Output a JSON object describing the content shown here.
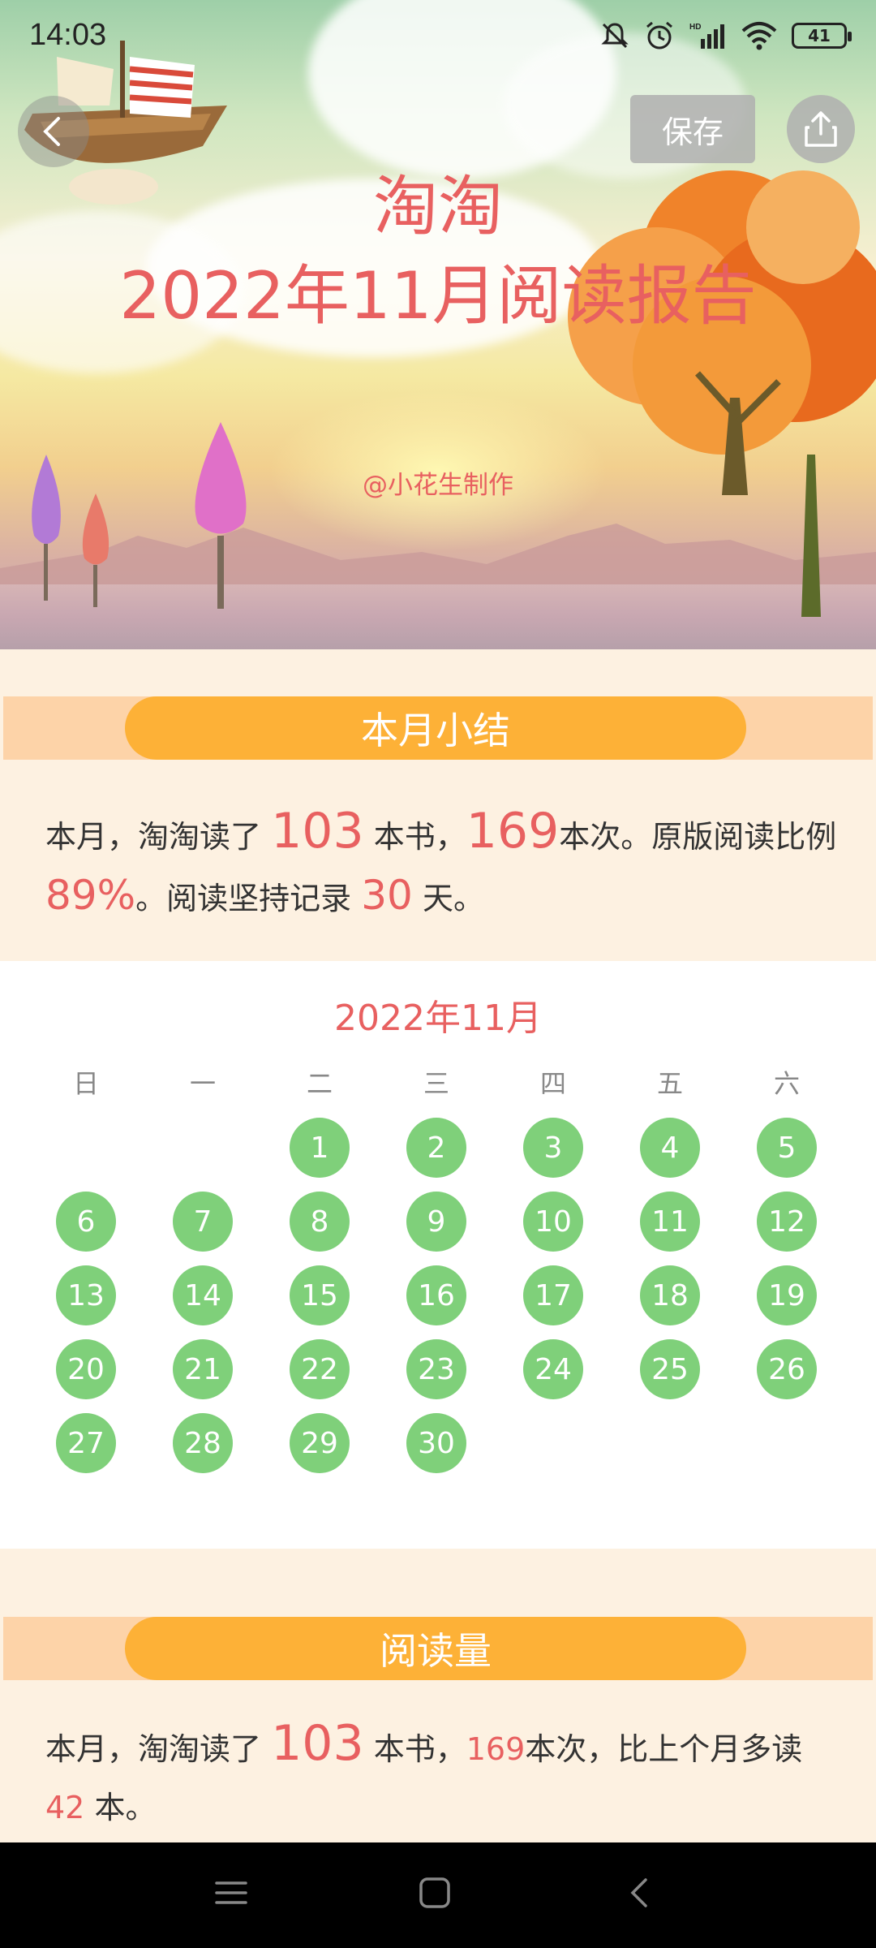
{
  "status_bar": {
    "time": "14:03",
    "battery": "41"
  },
  "header": {
    "save_label": "保存",
    "reader_name": "淘淘",
    "report_title": "2022年11月阅读报告",
    "credit": "@小花生制作"
  },
  "summary": {
    "heading": "本月小结",
    "t1": "本月，淘淘读了 ",
    "books": "103",
    "t2": " 本书，",
    "times": "169",
    "t3": "本次。原版阅读比例",
    "ratio": "89%",
    "t4": "。阅读坚持记录 ",
    "days": "30",
    "t5": " 天。"
  },
  "calendar": {
    "title": "2022年11月",
    "weekdays": [
      "日",
      "一",
      "二",
      "三",
      "四",
      "五",
      "六"
    ],
    "first_weekday_index": 2,
    "days": [
      "1",
      "2",
      "3",
      "4",
      "5",
      "6",
      "7",
      "8",
      "9",
      "10",
      "11",
      "12",
      "13",
      "14",
      "15",
      "16",
      "17",
      "18",
      "19",
      "20",
      "21",
      "22",
      "23",
      "24",
      "25",
      "26",
      "27",
      "28",
      "29",
      "30"
    ],
    "highlight_color": "#7fd07a"
  },
  "reading": {
    "heading": "阅读量",
    "t1": "本月，淘淘读了 ",
    "books": "103",
    "t2": " 本书，",
    "times": "169",
    "t3": "本次，比上个月多读 ",
    "more": "42",
    "t4": " 本。"
  },
  "colors": {
    "accent_red": "#e86060",
    "pill_orange": "#fdb137",
    "band_peach": "#fdd3a8",
    "page_bg": "#fdf1e1"
  },
  "icons": {
    "back": "chevron-left-icon",
    "share": "share-icon",
    "nav_menu": "menu-icon",
    "nav_home": "home-icon",
    "nav_back": "back-icon"
  }
}
